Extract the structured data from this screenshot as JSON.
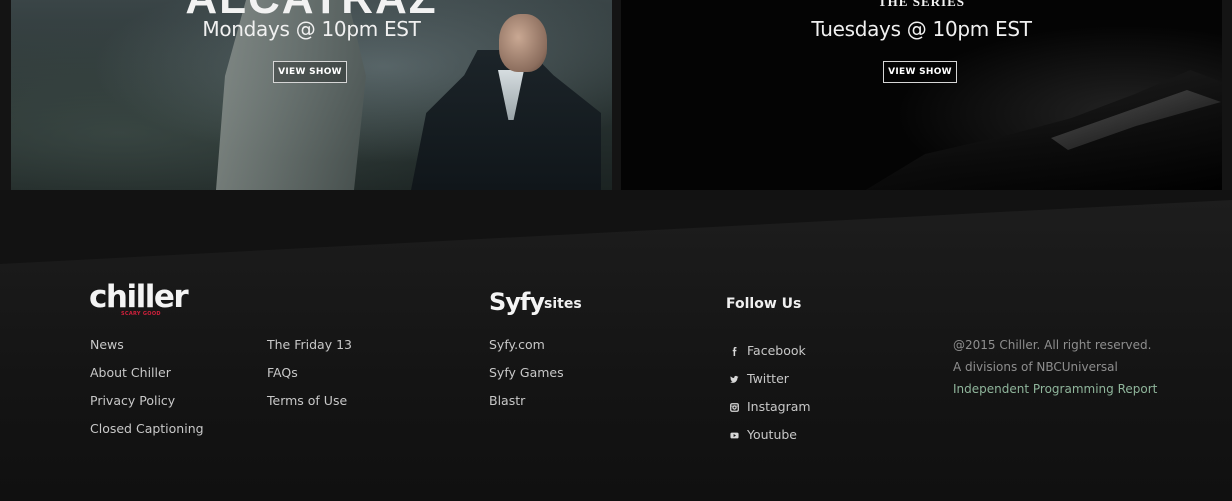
{
  "banners": [
    {
      "title": "ALCATRAZ",
      "time": "Mondays @ 10pm EST",
      "button": "VIEW SHOW"
    },
    {
      "title": "THE SERIES",
      "time": "Tuesdays @ 10pm EST",
      "button": "VIEW SHOW"
    }
  ],
  "footer": {
    "logo": {
      "word": "chiller",
      "tagline": "SCARY GOOD"
    },
    "columns": {
      "main": [
        "News",
        "About Chiller",
        "Privacy Policy",
        "Closed Captioning"
      ],
      "more": [
        "The Friday 13",
        "FAQs",
        "Terms of Use"
      ]
    },
    "syfy": {
      "logo": "Syfy",
      "heading": "sites",
      "links": [
        "Syfy.com",
        "Syfy Games",
        "Blastr"
      ]
    },
    "follow": {
      "heading": "Follow Us",
      "links": [
        {
          "label": "Facebook",
          "icon": "facebook-icon"
        },
        {
          "label": "Twitter",
          "icon": "twitter-icon"
        },
        {
          "label": "Instagram",
          "icon": "instagram-icon"
        },
        {
          "label": "Youtube",
          "icon": "youtube-icon"
        }
      ]
    },
    "legal": {
      "copyright": "@2015 Chiller. All right reserved.",
      "division": "A divisions of NBCUniversal",
      "report": "Independent Programming Report"
    }
  },
  "colors": {
    "background": "#141414",
    "link_text": "#c8c8c8",
    "legal_text": "#8e8e8e",
    "report_link": "#8fb59b",
    "chiller_red": "#d0203c"
  }
}
